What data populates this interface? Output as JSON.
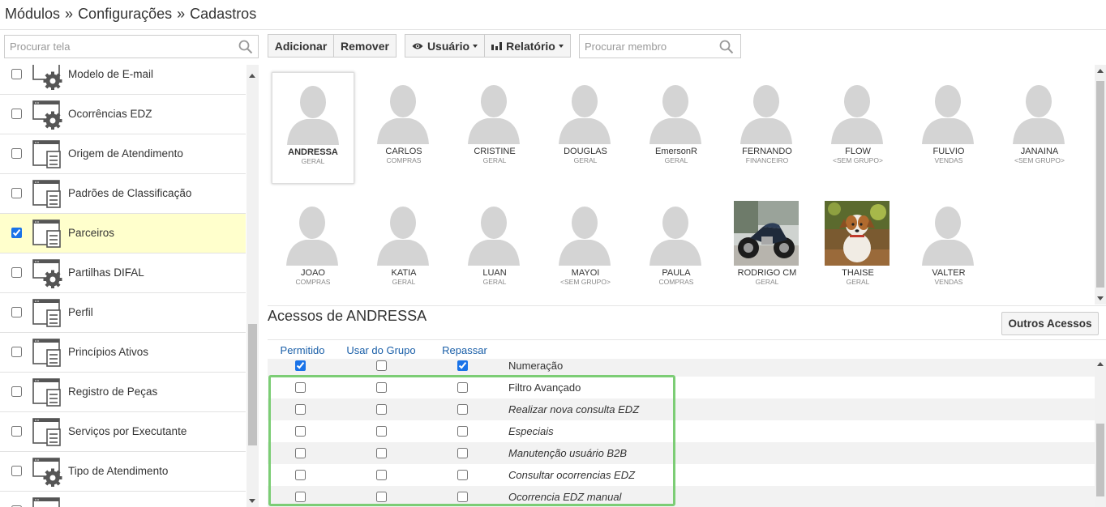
{
  "breadcrumb": [
    "Módulos",
    "»",
    "Configurações",
    "»",
    "Cadastros"
  ],
  "left_panel": {
    "search_placeholder": "Procurar tela",
    "items": [
      {
        "label": "Modelo de E-mail",
        "icon": "gear-window-icon",
        "checked": false,
        "selected": false
      },
      {
        "label": "Ocorrências EDZ",
        "icon": "gear-window-icon",
        "checked": false,
        "selected": false
      },
      {
        "label": "Origem de Atendimento",
        "icon": "form-window-icon",
        "checked": false,
        "selected": false
      },
      {
        "label": "Padrões de Classificação",
        "icon": "form-window-icon",
        "checked": false,
        "selected": false
      },
      {
        "label": "Parceiros",
        "icon": "form-window-icon",
        "checked": true,
        "selected": true
      },
      {
        "label": "Partilhas DIFAL",
        "icon": "gear-window-icon",
        "checked": false,
        "selected": false
      },
      {
        "label": "Perfil",
        "icon": "form-window-icon",
        "checked": false,
        "selected": false
      },
      {
        "label": "Princípios Ativos",
        "icon": "form-window-icon",
        "checked": false,
        "selected": false
      },
      {
        "label": "Registro de Peças",
        "icon": "form-window-icon",
        "checked": false,
        "selected": false
      },
      {
        "label": "Serviços por Executante",
        "icon": "form-window-icon",
        "checked": false,
        "selected": false
      },
      {
        "label": "Tipo de Atendimento",
        "icon": "gear-window-icon",
        "checked": false,
        "selected": false
      },
      {
        "label": "",
        "icon": "form-window-icon",
        "checked": false,
        "selected": false
      }
    ]
  },
  "toolbar": {
    "add_label": "Adicionar",
    "remove_label": "Remover",
    "user_label": "Usuário",
    "report_label": "Relatório",
    "member_search_placeholder": "Procurar membro"
  },
  "members": [
    {
      "name": "ANDRESSA",
      "group": "GERAL",
      "selected": true,
      "avatar": "default"
    },
    {
      "name": "CARLOS",
      "group": "COMPRAS",
      "avatar": "default"
    },
    {
      "name": "CRISTINE",
      "group": "GERAL",
      "avatar": "default"
    },
    {
      "name": "DOUGLAS",
      "group": "GERAL",
      "avatar": "default"
    },
    {
      "name": "EmersonR",
      "group": "GERAL",
      "avatar": "default"
    },
    {
      "name": "FERNANDO",
      "group": "FINANCEIRO",
      "avatar": "default"
    },
    {
      "name": "FLOW",
      "group": "<SEM GRUPO>",
      "avatar": "default"
    },
    {
      "name": "FULVIO",
      "group": "VENDAS",
      "avatar": "default"
    },
    {
      "name": "JANAINA",
      "group": "<SEM GRUPO>",
      "avatar": "default"
    },
    {
      "name": "JOAO",
      "group": "COMPRAS",
      "avatar": "default"
    },
    {
      "name": "KATIA",
      "group": "GERAL",
      "avatar": "default"
    },
    {
      "name": "LUAN",
      "group": "GERAL",
      "avatar": "default"
    },
    {
      "name": "MAYOI",
      "group": "<SEM GRUPO>",
      "avatar": "default"
    },
    {
      "name": "PAULA",
      "group": "COMPRAS",
      "avatar": "default"
    },
    {
      "name": "RODRIGO CM",
      "group": "GERAL",
      "avatar": "motorcycle-photo"
    },
    {
      "name": "THAISE",
      "group": "GERAL",
      "avatar": "dog-photo"
    },
    {
      "name": "VALTER",
      "group": "VENDAS",
      "avatar": "default"
    }
  ],
  "access": {
    "title": "Acessos de ANDRESSA",
    "other_button": "Outros Acessos",
    "columns": [
      "Permitido",
      "Usar do Grupo",
      "Repassar"
    ],
    "rows": [
      {
        "label": "Numeração",
        "italic": false,
        "permitido": true,
        "usar_grupo": false,
        "repassar": true
      },
      {
        "label": "Filtro Avançado",
        "italic": false,
        "permitido": false,
        "usar_grupo": false,
        "repassar": false
      },
      {
        "label": "Realizar nova consulta EDZ",
        "italic": true,
        "permitido": false,
        "usar_grupo": false,
        "repassar": false
      },
      {
        "label": "Especiais",
        "italic": true,
        "permitido": false,
        "usar_grupo": false,
        "repassar": false
      },
      {
        "label": "Manutenção usuário B2B",
        "italic": true,
        "permitido": false,
        "usar_grupo": false,
        "repassar": false
      },
      {
        "label": "Consultar ocorrencias EDZ",
        "italic": true,
        "permitido": false,
        "usar_grupo": false,
        "repassar": false
      },
      {
        "label": "Ocorrencia EDZ manual",
        "italic": true,
        "permitido": false,
        "usar_grupo": false,
        "repassar": false
      }
    ]
  },
  "colors": {
    "selected_row": "#ffffcc",
    "highlight_box": "#7ccd75",
    "column_header": "#1a5fa8"
  }
}
